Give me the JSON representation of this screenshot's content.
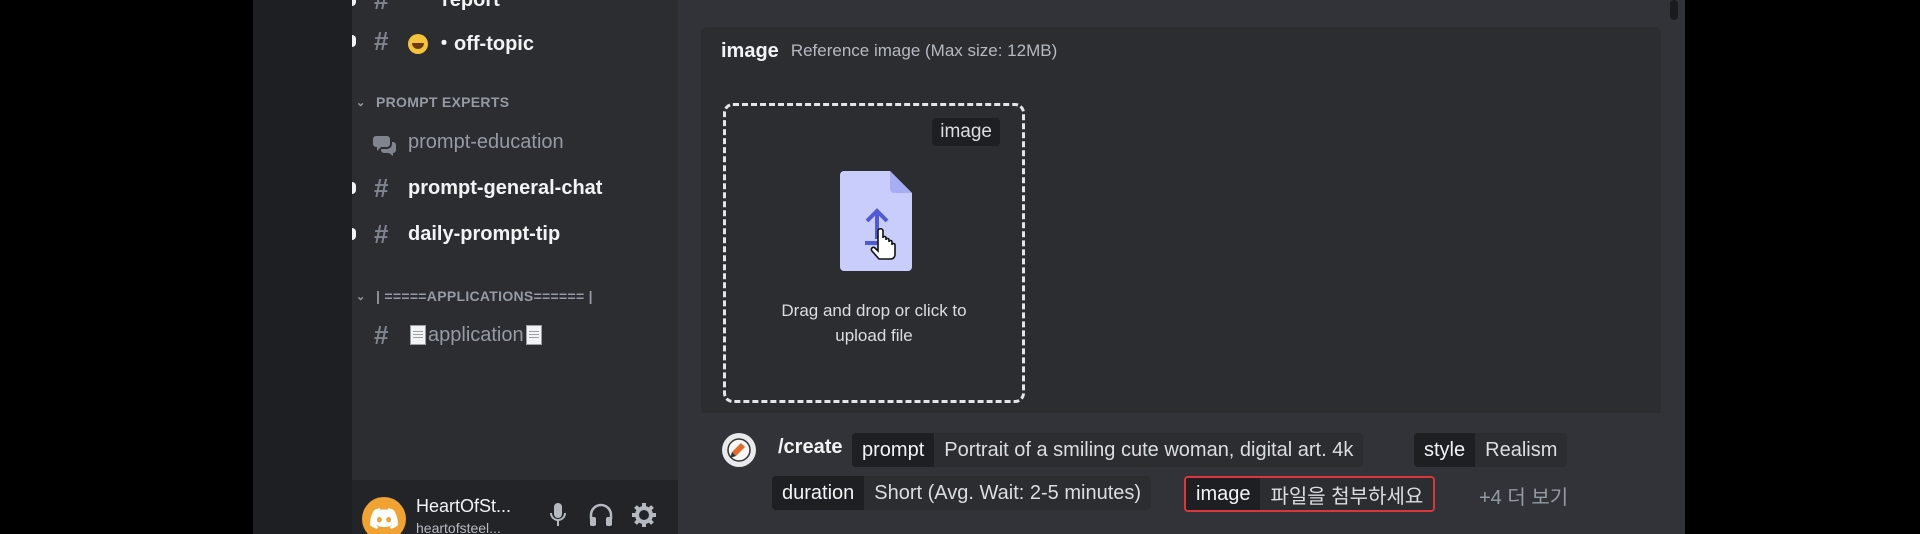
{
  "sidebar": {
    "top_channel": {
      "name": "report"
    },
    "off_topic": {
      "name": "・off-topic"
    },
    "categories": [
      {
        "label": "PROMPT EXPERTS"
      },
      {
        "label": "| =====APPLICATIONS====== |"
      }
    ],
    "channels": [
      {
        "name": "prompt-education"
      },
      {
        "name": "prompt-general-chat"
      },
      {
        "name": "daily-prompt-tip"
      },
      {
        "name": "application"
      }
    ]
  },
  "user": {
    "display_name": "HeartOfSt...",
    "username": "heartofsteel..."
  },
  "option": {
    "label": "image",
    "description": "Reference image (Max size: 12MB)"
  },
  "dropzone": {
    "tag": "image",
    "line1": "Drag and drop or click to",
    "line2": "upload file"
  },
  "command": {
    "name": "/create",
    "options": [
      {
        "key": "prompt",
        "value": "Portrait of a smiling cute woman, digital art. 4k"
      },
      {
        "key": "style",
        "value": "Realism"
      },
      {
        "key": "duration",
        "value": "Short (Avg. Wait: 2-5 minutes)"
      },
      {
        "key": "image",
        "value": "파일을 첨부하세요"
      }
    ],
    "more": "+4 더 보기"
  },
  "colors": {
    "sidebar_bg": "#2b2d31",
    "main_bg": "#313338",
    "rail_bg": "#1e1f22",
    "error_border": "#da373c",
    "upload_icon": "#c9cdfb"
  },
  "icons": [
    "hash-icon",
    "forum-icon",
    "upload-file-icon",
    "pointer-hand-icon",
    "discord-logo",
    "microphone-icon",
    "headphones-icon",
    "gear-icon",
    "command-app-icon"
  ]
}
